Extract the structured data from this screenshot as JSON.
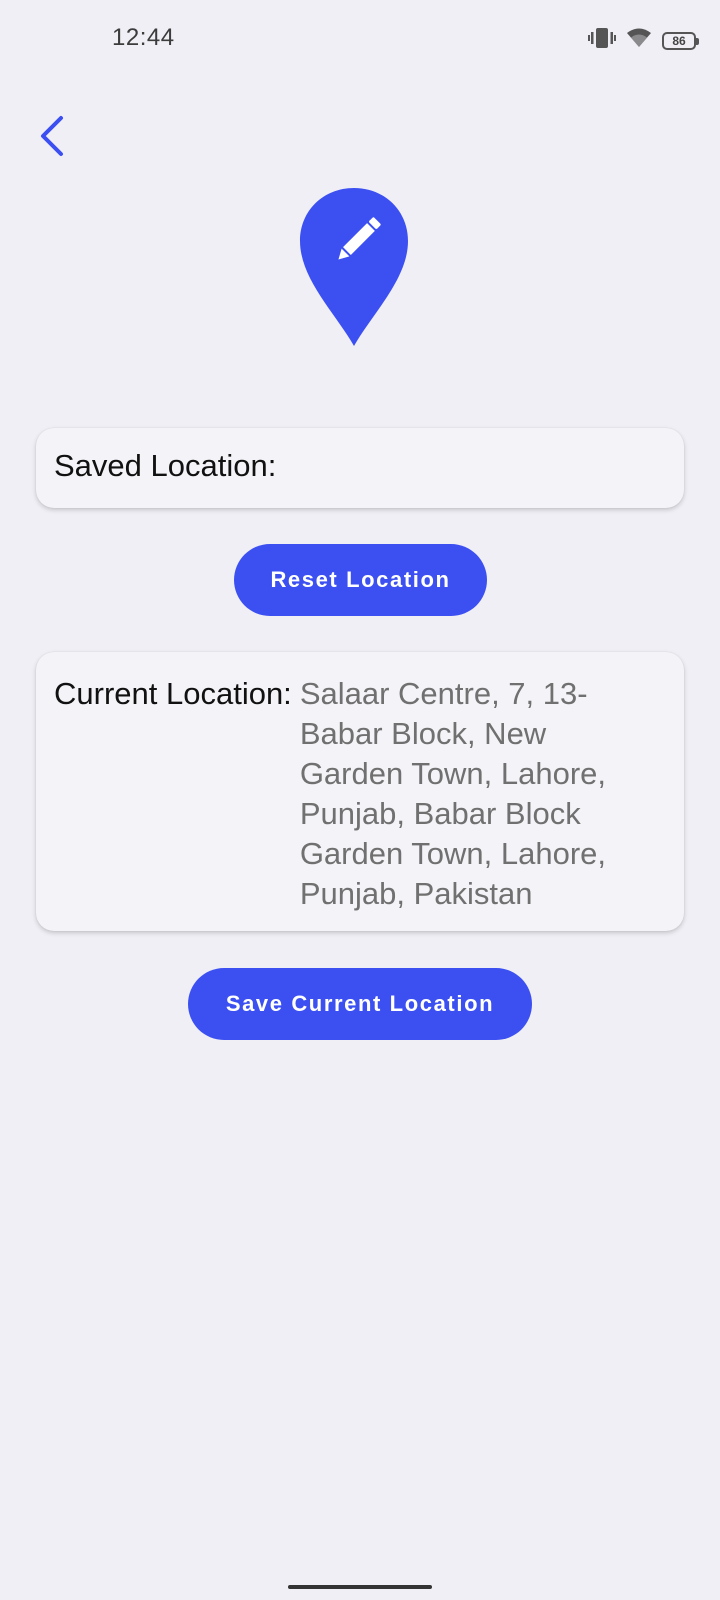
{
  "status_bar": {
    "time": "12:44",
    "battery_level": "86",
    "icons": [
      "vibrate-icon",
      "wifi-icon",
      "battery-icon"
    ]
  },
  "header": {
    "back_icon": "chevron-left-icon"
  },
  "hero_icon": "edit-location-pin-icon",
  "saved_location": {
    "label": "Saved Location:",
    "value": ""
  },
  "reset_button": {
    "label": "Reset Location"
  },
  "current_location": {
    "label": "Current Location:",
    "address": "Salaar Centre, 7, 13-Babar Block, New Garden Town, Lahore, Punjab, Babar Block Garden Town, Lahore, Punjab, Pakistan"
  },
  "save_button": {
    "label": "Save Current Location"
  },
  "colors": {
    "accent": "#3c50f2",
    "background": "#efeff5",
    "card": "#f4f3f8",
    "address_text": "#707070"
  }
}
